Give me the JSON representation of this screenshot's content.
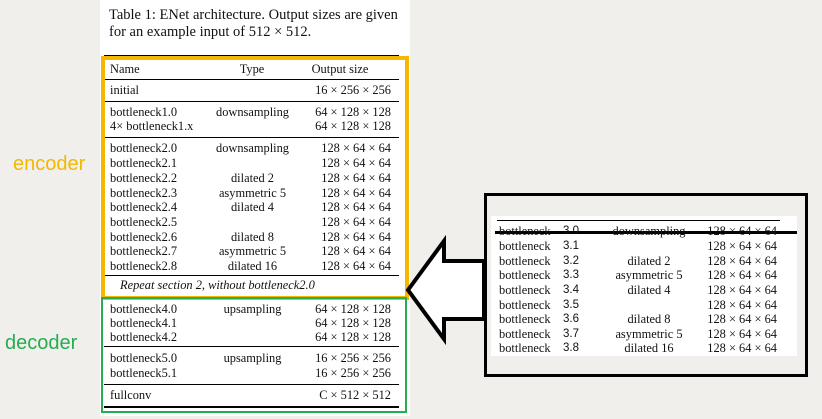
{
  "caption": {
    "line1": "Table 1: ENet architecture. Output sizes are given",
    "line2": "for an example input of 512 × 512."
  },
  "header": {
    "name": "Name",
    "type": "Type",
    "size": "Output size"
  },
  "rows": [
    {
      "name": "initial",
      "type": "",
      "size": "16 × 256 × 256"
    },
    {
      "name": "bottleneck1.0",
      "type": "downsampling",
      "size": "64 × 128 × 128"
    },
    {
      "name": "4× bottleneck1.x",
      "type": "",
      "size": "64 × 128 × 128"
    },
    {
      "name": "bottleneck2.0",
      "type": "downsampling",
      "size": "128 × 64 × 64"
    },
    {
      "name": "bottleneck2.1",
      "type": "",
      "size": "128 × 64 × 64"
    },
    {
      "name": "bottleneck2.2",
      "type": "dilated 2",
      "size": "128 × 64 × 64"
    },
    {
      "name": "bottleneck2.3",
      "type": "asymmetric 5",
      "size": "128 × 64 × 64"
    },
    {
      "name": "bottleneck2.4",
      "type": "dilated 4",
      "size": "128 × 64 × 64"
    },
    {
      "name": "bottleneck2.5",
      "type": "",
      "size": "128 × 64 × 64"
    },
    {
      "name": "bottleneck2.6",
      "type": "dilated 8",
      "size": "128 × 64 × 64"
    },
    {
      "name": "bottleneck2.7",
      "type": "asymmetric 5",
      "size": "128 × 64 × 64"
    },
    {
      "name": "bottleneck2.8",
      "type": "dilated 16",
      "size": "128 × 64 × 64"
    },
    {
      "name": "bottleneck4.0",
      "type": "upsampling",
      "size": "64 × 128 × 128"
    },
    {
      "name": "bottleneck4.1",
      "type": "",
      "size": "64 × 128 × 128"
    },
    {
      "name": "bottleneck4.2",
      "type": "",
      "size": "64 × 128 × 128"
    },
    {
      "name": "bottleneck5.0",
      "type": "upsampling",
      "size": "16 × 256 × 256"
    },
    {
      "name": "bottleneck5.1",
      "type": "",
      "size": "16 × 256 × 256"
    },
    {
      "name": "fullconv",
      "type": "",
      "size": "C × 512 × 512"
    }
  ],
  "repeat_note": "Repeat section 2, without bottleneck2.0",
  "labels": {
    "encoder": "encoder",
    "decoder": "decoder",
    "encoder_color": "#f5b800",
    "decoder_color": "#27ad50"
  },
  "zoom_rows": [
    {
      "name": "bottleneck",
      "num": "3.0",
      "type": "downsampling",
      "size": "128 × 64 × 64"
    },
    {
      "name": "bottleneck",
      "num": "3.1",
      "type": "",
      "size": "128 × 64 × 64"
    },
    {
      "name": "bottleneck",
      "num": "3.2",
      "type": "dilated 2",
      "size": "128 × 64 × 64"
    },
    {
      "name": "bottleneck",
      "num": "3.3",
      "type": "asymmetric 5",
      "size": "128 × 64 × 64"
    },
    {
      "name": "bottleneck",
      "num": "3.4",
      "type": "dilated 4",
      "size": "128 × 64 × 64"
    },
    {
      "name": "bottleneck",
      "num": "3.5",
      "type": "",
      "size": "128 × 64 × 64"
    },
    {
      "name": "bottleneck",
      "num": "3.6",
      "type": "dilated 8",
      "size": "128 × 64 × 64"
    },
    {
      "name": "bottleneck",
      "num": "3.7",
      "type": "asymmetric 5",
      "size": "128 × 64 × 64"
    },
    {
      "name": "bottleneck",
      "num": "3.8",
      "type": "dilated 16",
      "size": "128 × 64 × 64"
    }
  ]
}
